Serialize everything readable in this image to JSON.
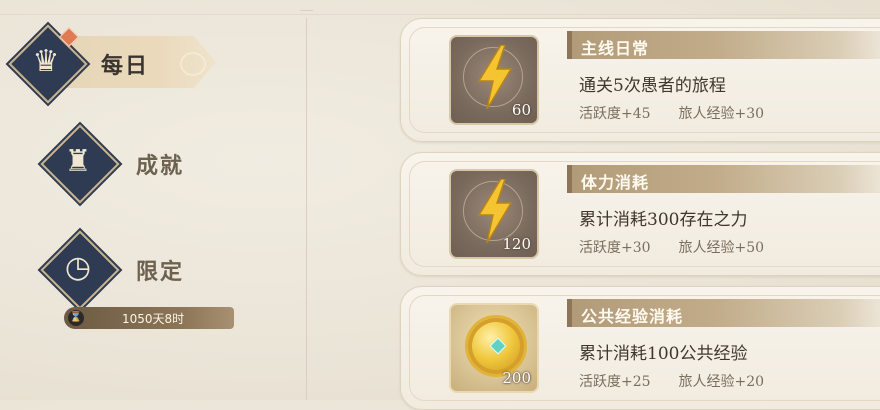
{
  "sidebar": {
    "tabs": [
      {
        "label": "每日",
        "icon": "calendar-crown-icon",
        "selected": true,
        "has_badge": true
      },
      {
        "label": "成就",
        "icon": "trophy-icon",
        "selected": false
      },
      {
        "label": "限定",
        "icon": "clock-icon",
        "selected": false,
        "timer": "1050天8时"
      }
    ]
  },
  "quests": [
    {
      "category": "主线日常",
      "description": "通关5次愚者的旅程",
      "item_icon": "lightning-icon",
      "quantity": "60",
      "activity": "活跃度+45",
      "exp": "旅人经验+30"
    },
    {
      "category": "体力消耗",
      "description": "累计消耗300存在之力",
      "item_icon": "lightning-icon",
      "quantity": "120",
      "activity": "活跃度+30",
      "exp": "旅人经验+50"
    },
    {
      "category": "公共经验消耗",
      "description": "累计消耗100公共经验",
      "item_icon": "gold-coin-icon",
      "quantity": "200",
      "activity": "活跃度+25",
      "exp": "旅人经验+20"
    }
  ],
  "colors": {
    "accent": "#2f3b52",
    "tag": "#b19a78",
    "badge": "#e07a52"
  }
}
